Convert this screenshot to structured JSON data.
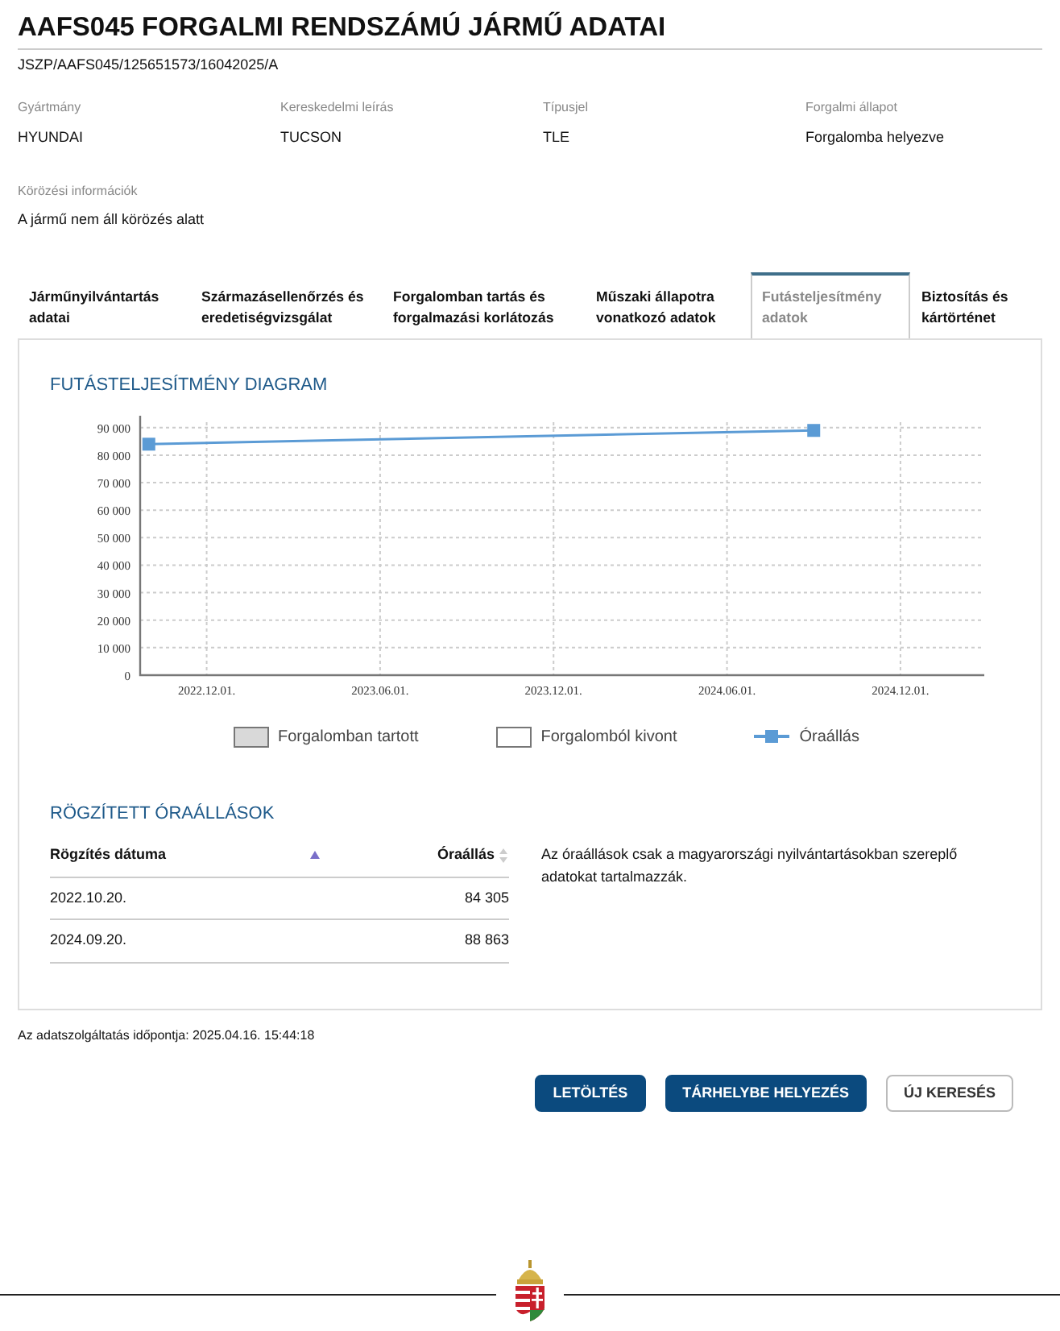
{
  "page": {
    "title": "AAFS045 FORGALMI RENDSZÁMÚ JÁRMŰ ADATAI",
    "reference": "JSZP/AAFS045/125651573/16042025/A"
  },
  "fields": [
    {
      "label": "Gyártmány",
      "value": "HYUNDAI"
    },
    {
      "label": "Kereskedelmi leírás",
      "value": "TUCSON"
    },
    {
      "label": "Típusjel",
      "value": "TLE"
    },
    {
      "label": "Forgalmi állapot",
      "value": "Forgalomba helyezve"
    }
  ],
  "wanted": {
    "label": "Körözési információk",
    "value": "A jármű nem áll körözés alatt"
  },
  "tabs": [
    {
      "label": "Járműnyilvántartás adatai",
      "selected": false
    },
    {
      "label": "Származásellenőrzés és eredetiségvizsgálat",
      "selected": false
    },
    {
      "label": "Forgalomban tartás és forgalmazási korlátozás",
      "selected": false
    },
    {
      "label": "Műszaki állapotra vonatkozó adatok",
      "selected": false
    },
    {
      "label": "Futásteljesítmény adatok",
      "selected": true
    },
    {
      "label": "Biztosítás és kártörténet",
      "selected": false
    }
  ],
  "chart": {
    "heading": "FUTÁSTELJESÍTMÉNY DIAGRAM",
    "chart_data": {
      "type": "line",
      "grid": true,
      "categories": [
        null,
        null,
        "2022.12.01.",
        null,
        null,
        null,
        null,
        null,
        "2023.06.01.",
        null,
        null,
        null,
        null,
        null,
        "2023.12.01.",
        null,
        null,
        null,
        null,
        null,
        "2024.06.01.",
        null,
        null,
        null,
        null,
        null,
        "2024.12.01.",
        null,
        null
      ],
      "series": [
        {
          "name": "Óraállás",
          "color": "#5b9bd5",
          "marker": "square",
          "values": [
            84000,
            null,
            null,
            null,
            null,
            null,
            null,
            null,
            null,
            null,
            null,
            null,
            null,
            null,
            null,
            null,
            null,
            null,
            null,
            null,
            null,
            null,
            null,
            89000,
            null,
            null,
            null,
            null,
            null
          ]
        }
      ],
      "ylim": [
        0,
        92000
      ],
      "yticks": [
        {
          "value": 0,
          "label": "0"
        },
        {
          "value": 10000,
          "label": "10 000"
        },
        {
          "value": 20000,
          "label": "20 000"
        },
        {
          "value": 30000,
          "label": "30 000"
        },
        {
          "value": 40000,
          "label": "40 000"
        },
        {
          "value": 50000,
          "label": "50 000"
        },
        {
          "value": 60000,
          "label": "60 000"
        },
        {
          "value": 70000,
          "label": "70 000"
        },
        {
          "value": 80000,
          "label": "80 000"
        },
        {
          "value": 90000,
          "label": "90 000"
        }
      ]
    },
    "legend": [
      {
        "kind": "box",
        "label": "Forgalomban tartott",
        "color": "#d9d9d9"
      },
      {
        "kind": "box",
        "label": "Forgalomból kivont",
        "color": "#ffffff"
      }
    ]
  },
  "readings": {
    "heading": "RÖGZÍTETT ÓRAÁLLÁSOK",
    "columns": [
      {
        "label": "Rögzítés dátuma",
        "sorted": true
      },
      {
        "label": "Óraállás",
        "sorted": false
      }
    ],
    "rows": [
      [
        "2022.10.20.",
        "84 305"
      ],
      [
        "2024.09.20.",
        "88 863"
      ]
    ],
    "note": "Az óraállások csak a magyarországi nyilvántartásokban szereplő adatokat tartalmazzák."
  },
  "timestamp": "Az adatszolgáltatás időpontja: 2025.04.16. 15:44:18",
  "buttons": [
    {
      "label": "LETÖLTÉS",
      "kind": "primary"
    },
    {
      "label": "TÁRHELYBE HELYEZÉS",
      "kind": "primary"
    },
    {
      "label": "ÚJ KERESÉS",
      "kind": "outline"
    }
  ]
}
